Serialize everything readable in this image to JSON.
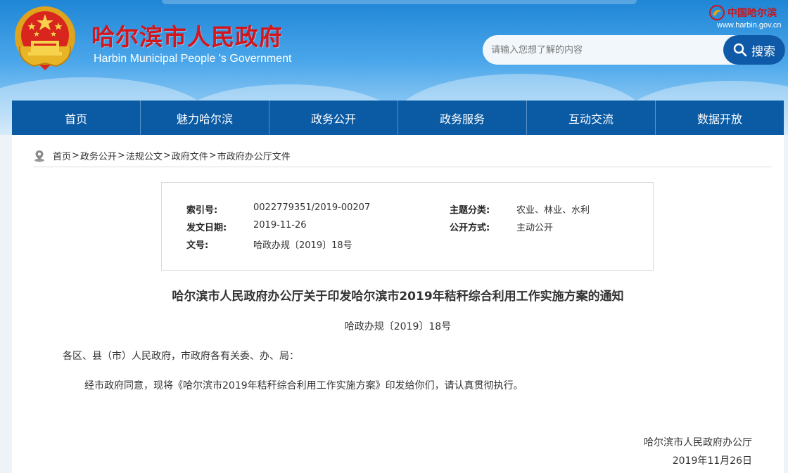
{
  "header": {
    "title": "哈尔滨市人民政府",
    "subtitle": "Harbin Municipal People 's Government",
    "portal_name": "中国哈尔滨",
    "portal_domain": "www.harbin.gov.cn"
  },
  "search": {
    "placeholder": "请输入您想了解的内容",
    "button_label": "搜索"
  },
  "nav": {
    "items": [
      {
        "label": "首页"
      },
      {
        "label": "魅力哈尔滨"
      },
      {
        "label": "政务公开"
      },
      {
        "label": "政务服务"
      },
      {
        "label": "互动交流"
      },
      {
        "label": "数据开放"
      }
    ]
  },
  "breadcrumb": {
    "items": [
      "首页",
      "政务公开",
      "法规公文",
      "政府文件",
      "市政府办公厅文件"
    ],
    "separator": ">"
  },
  "meta": {
    "index_label": "索引号:",
    "index_value": "0022779351/2019-00207",
    "topic_label": "主题分类:",
    "topic_value": "农业、林业、水利",
    "date_label": "发文日期:",
    "date_value": "2019-11-26",
    "publish_label": "公开方式:",
    "publish_value": "主动公开",
    "docno_label": "文号:",
    "docno_value": "哈政办规〔2019〕18号"
  },
  "document": {
    "title": "哈尔滨市人民政府办公厅关于印发哈尔滨市2019年秸秆综合利用工作实施方案的通知",
    "number": "哈政办规〔2019〕18号",
    "salutation": "各区、县（市）人民政府，市政府各有关委、办、局：",
    "body": "经市政府同意，现将《哈尔滨市2019年秸秆综合利用工作实施方案》印发给你们，请认真贯彻执行。",
    "signer": "哈尔滨市人民政府办公厅",
    "sign_date": "2019年11月26日"
  },
  "colors": {
    "nav_bg": "#0a5aa4",
    "title_red": "#d4161c",
    "search_button": "#0f5aa8"
  }
}
